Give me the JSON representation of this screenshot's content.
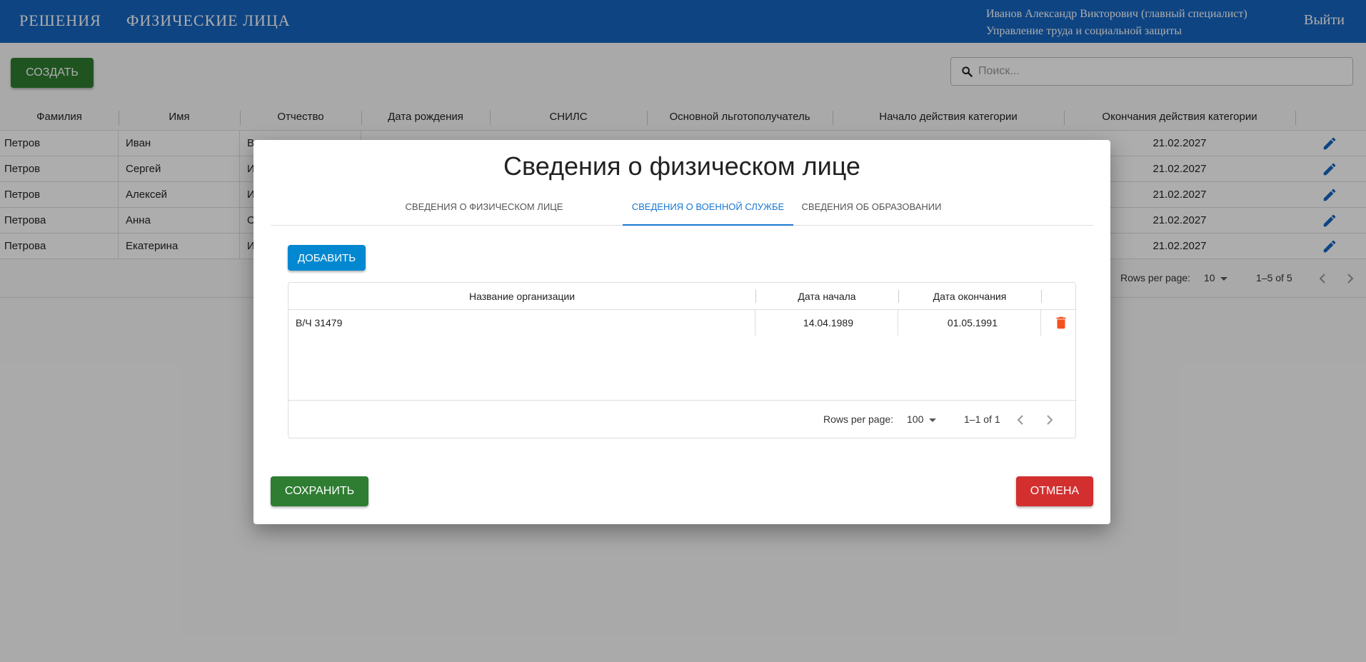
{
  "header": {
    "nav": [
      "РЕШЕНИЯ",
      "ФИЗИЧЕСКИЕ ЛИЦА"
    ],
    "user_name": "Иванов Александр Викторович (главный специалист)",
    "department": "Управление труда и социальной защиты",
    "logout": "Выйти"
  },
  "toolbar": {
    "create": "СОЗДАТЬ",
    "search_placeholder": "Поиск..."
  },
  "table": {
    "columns": [
      "Фамилия",
      "Имя",
      "Отчество",
      "Дата рождения",
      "СНИЛС",
      "Основной льготополучатель",
      "Начало действия категории",
      "Окончания действия категории"
    ],
    "rows": [
      {
        "last": "Петров",
        "first": "Иван",
        "middle": "В",
        "end": "21.02.2027"
      },
      {
        "last": "Петров",
        "first": "Сергей",
        "middle": "И",
        "end": "21.02.2027"
      },
      {
        "last": "Петров",
        "first": "Алексей",
        "middle": "И",
        "end": "21.02.2027"
      },
      {
        "last": "Петрова",
        "first": "Анна",
        "middle": "О",
        "end": "21.02.2027"
      },
      {
        "last": "Петрова",
        "first": "Екатерина",
        "middle": "И",
        "end": "21.02.2027"
      }
    ],
    "footer": {
      "rows_per_page_label": "Rows per page:",
      "rows_per_page": "10",
      "range": "1–5 of 5"
    }
  },
  "modal": {
    "title": "Сведения о физическом лице",
    "tabs": [
      "СВЕДЕНИЯ О ФИЗИЧЕСКОМ ЛИЦЕ",
      "СВЕДЕНИЯ О ВОЕННОЙ СЛУЖБЕ",
      "СВЕДЕНИЯ ОБ ОБРАЗОВАНИИ"
    ],
    "active_tab": 1,
    "add": "ДОБАВИТЬ",
    "service_table": {
      "columns": [
        "Название организации",
        "Дата начала",
        "Дата окончания"
      ],
      "rows": [
        {
          "org": "В/Ч 31479",
          "start": "14.04.1989",
          "end": "01.05.1991"
        }
      ],
      "footer": {
        "rows_per_page_label": "Rows per page:",
        "rows_per_page": "100",
        "range": "1–1 of 1"
      }
    },
    "save": "СОХРАНИТЬ",
    "cancel": "ОТМЕНА"
  },
  "colors": {
    "header": "#1565c0",
    "create_save": "#2e7d32",
    "add": "#0288d1",
    "cancel": "#d32f2f",
    "active_tab": "#1976d2",
    "edit_icon": "#1565c0",
    "delete_icon": "#f4511e"
  },
  "icons": {
    "search": "search-icon",
    "edit": "pencil-icon",
    "delete": "trash-icon",
    "dropdown": "caret-down-icon",
    "prev": "chevron-left-icon",
    "next": "chevron-right-icon"
  }
}
